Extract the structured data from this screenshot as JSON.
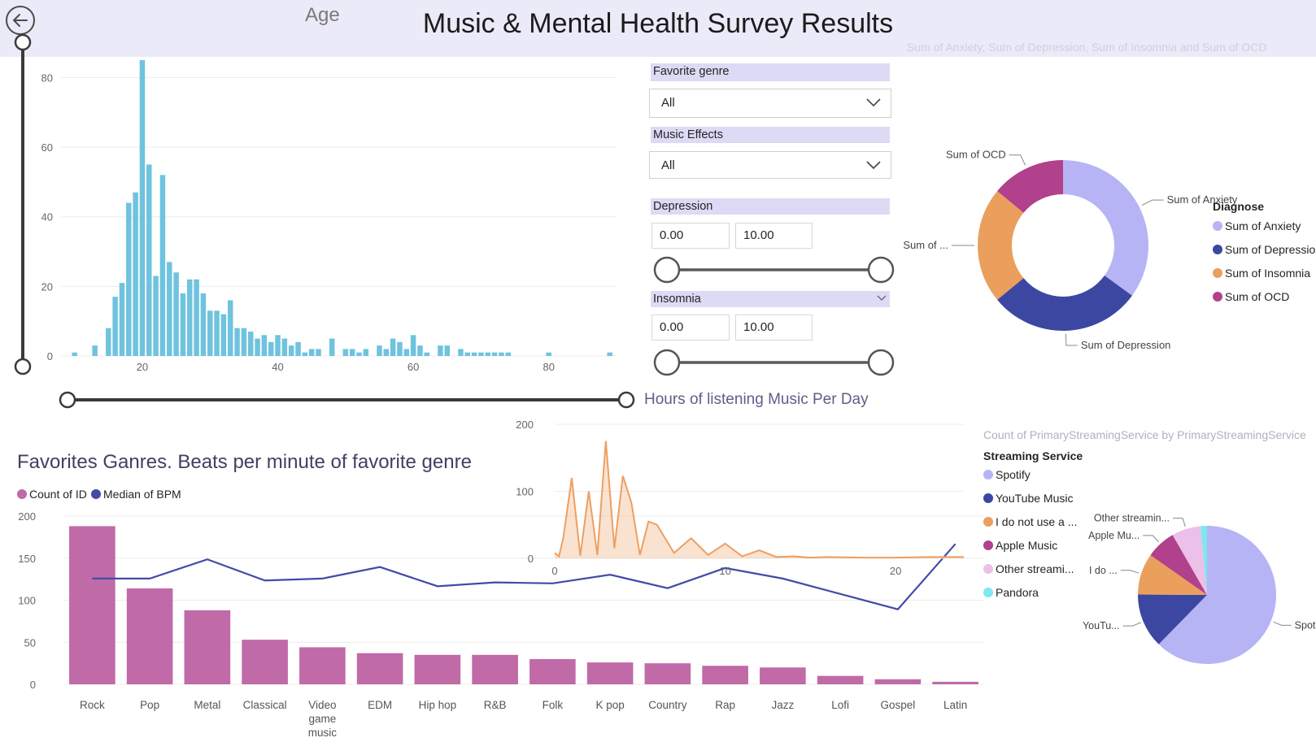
{
  "header": {
    "title": "Music & Mental Health Survey Results",
    "age_label": "Age",
    "donut_caption": "Sum of Anxiety, Sum of Depression, Sum of Insomnia and Sum of OCD"
  },
  "filters": {
    "favorite_genre": {
      "label": "Favorite genre",
      "value": "All"
    },
    "music_effects": {
      "label": "Music Effects",
      "value": "All"
    },
    "depression": {
      "label": "Depression",
      "min": "0.00",
      "max": "10.00"
    },
    "insomnia": {
      "label": "Insomnia",
      "min": "0.00",
      "max": "10.00"
    }
  },
  "hours_label": "Hours of listening Music Per Day",
  "favorites_title": "Favorites Ganres. Beats per minute of favorite genre",
  "streaming_caption": "Count of PrimaryStreamingService by PrimaryStreamingService",
  "donut_legend": {
    "title": "Diagnose",
    "items": [
      "Sum of Anxiety",
      "Sum of Depression",
      "Sum of Insomnia",
      "Sum of OCD"
    ]
  },
  "streaming_legend": {
    "title": "Streaming Service",
    "items": [
      "Spotify",
      "YouTube Music",
      "I do not use a ...",
      "Apple Music",
      "Other streami...",
      "Pandora"
    ]
  },
  "colors": {
    "histogram": "#6fc3de",
    "anxiety": "#b7b4f5",
    "depression": "#3c47a2",
    "insomnia": "#ea9f5d",
    "ocd": "#b1418c",
    "apple": "#b1418c",
    "other": "#ecc0e8",
    "pandora": "#7de8ee",
    "genre_bar": "#c06aa8",
    "bpm_line": "#424ba6",
    "hours_area": "#ed9f62",
    "filter_head": "#dcdaf5",
    "header_bg": "#ebeaf8"
  },
  "chart_data": [
    {
      "type": "bar",
      "name": "age-histogram",
      "xlabel": "Age",
      "x": [
        10,
        13,
        15,
        16,
        17,
        18,
        19,
        20,
        21,
        22,
        23,
        24,
        25,
        26,
        27,
        28,
        29,
        30,
        31,
        32,
        33,
        34,
        35,
        36,
        37,
        38,
        39,
        40,
        41,
        42,
        43,
        44,
        45,
        46,
        48,
        50,
        51,
        52,
        53,
        55,
        56,
        57,
        58,
        59,
        60,
        61,
        62,
        64,
        65,
        67,
        68,
        69,
        70,
        71,
        72,
        73,
        74,
        80,
        89
      ],
      "values": [
        1,
        3,
        8,
        17,
        21,
        44,
        47,
        85,
        55,
        23,
        52,
        27,
        24,
        18,
        22,
        22,
        18,
        13,
        13,
        12,
        16,
        8,
        8,
        7,
        5,
        6,
        4,
        6,
        5,
        3,
        4,
        1,
        2,
        2,
        5,
        2,
        2,
        1,
        2,
        3,
        2,
        5,
        4,
        2,
        6,
        3,
        1,
        3,
        3,
        2,
        1,
        1,
        1,
        1,
        1,
        1,
        1,
        1,
        1
      ],
      "xticks": [
        "20",
        "40",
        "60",
        "80"
      ],
      "yticks": [
        "0",
        "20",
        "40",
        "60",
        "80"
      ],
      "xlim": [
        8,
        90
      ],
      "ylim": [
        0,
        85
      ]
    },
    {
      "type": "pie",
      "name": "diagnose-donut",
      "labels": [
        "Sum of Anxiety",
        "Sum of Depression",
        "Sum of Insomnia",
        "Sum of OCD"
      ],
      "slice_labels": [
        "Sum of Anxiety",
        "Sum of Depression",
        "Sum of ...",
        "Sum of OCD"
      ],
      "values": [
        35,
        29,
        22,
        14
      ]
    },
    {
      "type": "area",
      "name": "hours-per-day",
      "x": [
        0,
        0.25,
        0.5,
        1,
        1.5,
        2,
        2.5,
        3,
        3.5,
        4,
        4.5,
        5,
        5.5,
        6,
        7,
        8,
        9,
        10,
        11,
        12,
        13,
        14,
        15,
        16,
        18,
        20,
        22,
        24
      ],
      "values": [
        8,
        3,
        30,
        120,
        4,
        100,
        5,
        175,
        15,
        123,
        83,
        5,
        55,
        50,
        8,
        30,
        5,
        22,
        3,
        12,
        2,
        3,
        1,
        2,
        1,
        1,
        2,
        2
      ],
      "xticks": [
        "0",
        "10",
        "20"
      ],
      "yticks": [
        "0",
        "100",
        "200"
      ],
      "xlim": [
        0,
        24
      ],
      "ylim": [
        0,
        200
      ]
    },
    {
      "type": "bar",
      "name": "favorite-genres",
      "categories": [
        "Rock",
        "Pop",
        "Metal",
        "Classical",
        "Video game music",
        "EDM",
        "Hip hop",
        "R&B",
        "Folk",
        "K pop",
        "Country",
        "Rap",
        "Jazz",
        "Lofi",
        "Gospel",
        "Latin"
      ],
      "series": [
        {
          "name": "Count of ID",
          "values": [
            188,
            114,
            88,
            53,
            44,
            37,
            35,
            35,
            30,
            26,
            25,
            22,
            20,
            10,
            6,
            3
          ]
        },
        {
          "name": "Median of BPM",
          "values": [
            120,
            120,
            140,
            118,
            120,
            132,
            112,
            116,
            115,
            124,
            110,
            131,
            120,
            104,
            88,
            156
          ]
        }
      ],
      "yticks": [
        "0",
        "50",
        "100",
        "150",
        "200"
      ],
      "ylim": [
        0,
        200
      ]
    },
    {
      "type": "pie",
      "name": "streaming-pie",
      "labels": [
        "Spotify",
        "YouTube Music",
        "I do not use a ...",
        "Apple Music",
        "Other streami...",
        "Pandora"
      ],
      "slice_labels": [
        "Spotify",
        "YouTu...",
        "I do ...",
        "Apple Mu...",
        "Other streamin..."
      ],
      "values": [
        458,
        94,
        71,
        51,
        50,
        11
      ]
    }
  ]
}
